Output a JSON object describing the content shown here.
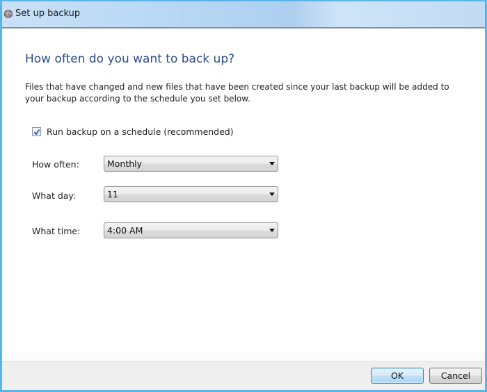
{
  "window": {
    "title": "Set up backup",
    "icon": "backup-globe-icon"
  },
  "main": {
    "heading": "How often do you want to back up?",
    "description": "Files that have changed and new files that have been created since your last backup will be added to your backup according to the schedule you set below.",
    "schedule_checkbox": {
      "label": "Run backup on a schedule (recommended)",
      "checked": true
    },
    "fields": [
      {
        "label": "How often:",
        "value": "Monthly"
      },
      {
        "label": "What day:",
        "value": "11"
      },
      {
        "label": "What time:",
        "value": "4:00 AM"
      }
    ]
  },
  "footer": {
    "ok_label": "OK",
    "cancel_label": "Cancel"
  },
  "colors": {
    "heading": "#2a4d8a",
    "window_border": "#5ab4e8",
    "footer_bg": "#efefef"
  }
}
